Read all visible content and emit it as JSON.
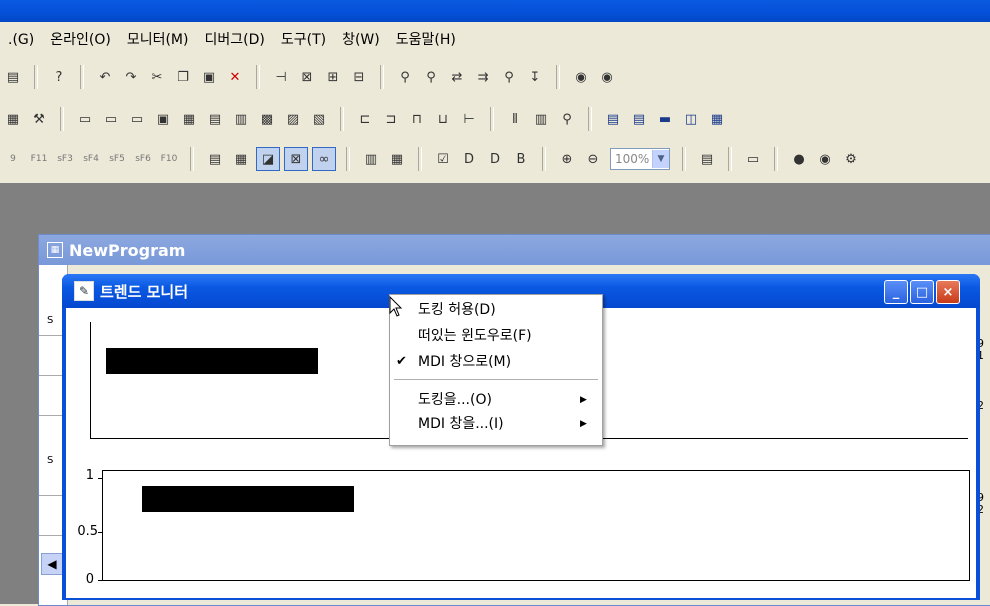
{
  "menubar": {
    "items": [
      ".(G)",
      "온라인(O)",
      "모니터(M)",
      "디버그(D)",
      "도구(T)",
      "창(W)",
      "도움말(H)"
    ]
  },
  "toolbar3": {
    "fkeys": [
      "9",
      "F11",
      "sF3",
      "sF4",
      "sF5",
      "sF6",
      "F10"
    ],
    "zoom": "100%"
  },
  "new_program": {
    "title": "NewProgram",
    "left_gutter_marks": [
      "S",
      "S"
    ],
    "right_gutter_digits": [
      "9",
      "1",
      "2",
      "9",
      "2"
    ]
  },
  "trend_monitor": {
    "title": "트렌드 모니터",
    "controls": {
      "minimize": "_",
      "maximize": "□",
      "close": "×"
    },
    "bottom_chart": {
      "y_ticks": [
        "1",
        "0.5",
        "0"
      ]
    }
  },
  "context_menu": {
    "items": [
      {
        "label": "도킹 허용(D)",
        "checked": false,
        "submenu": false
      },
      {
        "label": "떠있는 윈도우로(F)",
        "checked": false,
        "submenu": false
      },
      {
        "label": "MDI 창으로(M)",
        "checked": true,
        "submenu": false
      },
      {
        "label": "도킹을...(O)",
        "checked": false,
        "submenu": true
      },
      {
        "label": "MDI 창을...(I)",
        "checked": false,
        "submenu": true
      }
    ]
  },
  "icons": {
    "check": "✔",
    "submenu_arrow": "▶",
    "scroll_left": "◀"
  }
}
